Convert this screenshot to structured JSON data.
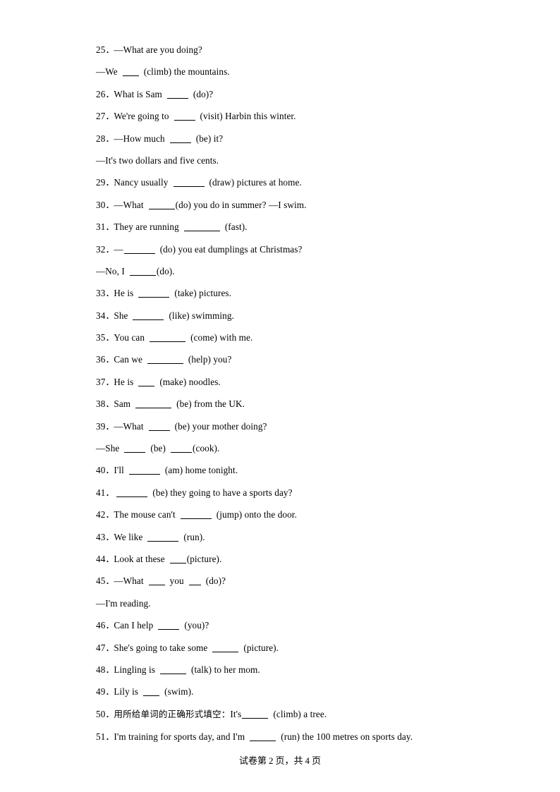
{
  "document": {
    "page_background": "#ffffff",
    "text_color": "#000000",
    "footer": {
      "prefix": "试卷第",
      "current_page": "2",
      "middle": "页，共",
      "total_pages": "4",
      "suffix": "页",
      "full_text": "试卷第 2 页，共 4 页"
    }
  },
  "questions": [
    {
      "number": "25",
      "lines": [
        {
          "type": "main",
          "text": "—What are you doing?"
        },
        {
          "type": "cont",
          "text": "—We ____ (climb) the mountains."
        }
      ]
    },
    {
      "number": "26",
      "lines": [
        {
          "type": "main",
          "text": "What is Sam _____ (do)?"
        }
      ]
    },
    {
      "number": "27",
      "lines": [
        {
          "type": "main",
          "text": "We're going to _____ (visit) Harbin this winter."
        }
      ]
    },
    {
      "number": "28",
      "lines": [
        {
          "type": "main",
          "text": "—How much _____ (be) it?"
        },
        {
          "type": "cont",
          "text": "—It's two dollars and five cents."
        }
      ]
    },
    {
      "number": "29",
      "lines": [
        {
          "type": "main",
          "text": "Nancy usually ______ (draw) pictures at home."
        }
      ]
    },
    {
      "number": "30",
      "lines": [
        {
          "type": "main",
          "text": "—What _____(do) you do in summer? —I swim."
        }
      ]
    },
    {
      "number": "31",
      "lines": [
        {
          "type": "main",
          "text": "They are running ________ (fast)."
        }
      ]
    },
    {
      "number": "32",
      "lines": [
        {
          "type": "main",
          "text": "—______ (do) you eat dumplings at Christmas?"
        },
        {
          "type": "cont",
          "text": "—No, I _____(do)."
        }
      ]
    },
    {
      "number": "33",
      "lines": [
        {
          "type": "main",
          "text": "He is ______ (take) pictures."
        }
      ]
    },
    {
      "number": "34",
      "lines": [
        {
          "type": "main",
          "text": "She ______ (like) swimming."
        }
      ]
    },
    {
      "number": "35",
      "lines": [
        {
          "type": "main",
          "text": "You can _______ (come) with me."
        }
      ]
    },
    {
      "number": "36",
      "lines": [
        {
          "type": "main",
          "text": "Can we _______ (help) you?"
        }
      ]
    },
    {
      "number": "37",
      "lines": [
        {
          "type": "main",
          "text": "He is ____ (make) noodles."
        }
      ]
    },
    {
      "number": "38",
      "lines": [
        {
          "type": "main",
          "text": "Sam _______ (be) from the UK."
        }
      ]
    },
    {
      "number": "39",
      "lines": [
        {
          "type": "main",
          "text": "—What ____ (be) your mother doing?"
        },
        {
          "type": "cont",
          "text": "—She ____ (be) ____(cook)."
        }
      ]
    },
    {
      "number": "40",
      "lines": [
        {
          "type": "main",
          "text": "I'll ______ (am) home tonight."
        }
      ]
    },
    {
      "number": "41",
      "lines": [
        {
          "type": "main",
          "text": "______ (be) they going to have a sports day?"
        }
      ]
    },
    {
      "number": "42",
      "lines": [
        {
          "type": "main",
          "text": "The mouse can't ______ (jump) onto the door."
        }
      ]
    },
    {
      "number": "43",
      "lines": [
        {
          "type": "main",
          "text": "We like ______ (run)."
        }
      ]
    },
    {
      "number": "44",
      "lines": [
        {
          "type": "main",
          "text": "Look at these ___(picture)."
        }
      ]
    },
    {
      "number": "45",
      "lines": [
        {
          "type": "main",
          "text": "—What ___ you __ (do)?"
        },
        {
          "type": "cont",
          "text": "—I'm reading."
        }
      ]
    },
    {
      "number": "46",
      "lines": [
        {
          "type": "main",
          "text": "Can I help ____ (you)?"
        }
      ]
    },
    {
      "number": "47",
      "lines": [
        {
          "type": "main",
          "text": "She's going to take some _____ (picture)."
        }
      ]
    },
    {
      "number": "48",
      "lines": [
        {
          "type": "main",
          "text": "Lingling is _____ (talk) to her mom."
        }
      ]
    },
    {
      "number": "49",
      "lines": [
        {
          "type": "main",
          "text": "Lily is ___ (swim)."
        }
      ]
    },
    {
      "number": "50",
      "lines": [
        {
          "type": "main",
          "text": "用所给单词的正确形式填空：It's_____ (climb) a tree."
        }
      ]
    },
    {
      "number": "51",
      "lines": [
        {
          "type": "main",
          "text": "I'm training for sports day, and I'm _____ (run) the 100 metres on sports day."
        }
      ]
    }
  ]
}
